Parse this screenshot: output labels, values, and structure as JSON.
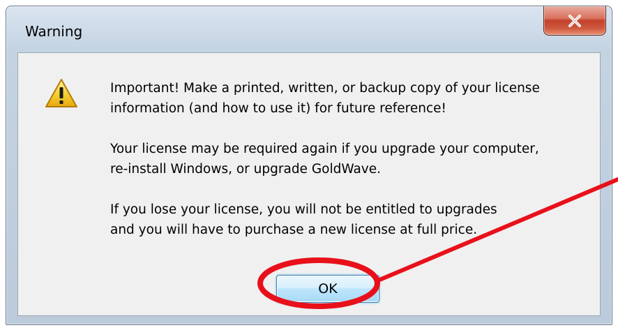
{
  "window": {
    "title": "Warning",
    "close_label": "X",
    "close_icon": "close-icon"
  },
  "dialog": {
    "icon": "warning-icon",
    "paragraphs": [
      {
        "line1": "Important!  Make a printed, written, or backup copy of your license",
        "line2": "information (and how to use it) for future reference!"
      },
      {
        "line1": "Your license may be required again if you upgrade your computer,",
        "line2": "re-install Windows, or upgrade GoldWave."
      },
      {
        "line1": "If you lose your license, you will not be entitled to upgrades",
        "line2": "and you will have to purchase a new license at full price."
      }
    ],
    "ok_label": "OK"
  },
  "annotation": {
    "shape": "ellipse-and-arrow",
    "color": "#e8101a"
  },
  "colors": {
    "client_background": "#f0f0f0",
    "frame": "#c4d3e2",
    "close_button": "#c2412a",
    "ok_button": "#bee6fd",
    "annotation": "#e8101a"
  }
}
